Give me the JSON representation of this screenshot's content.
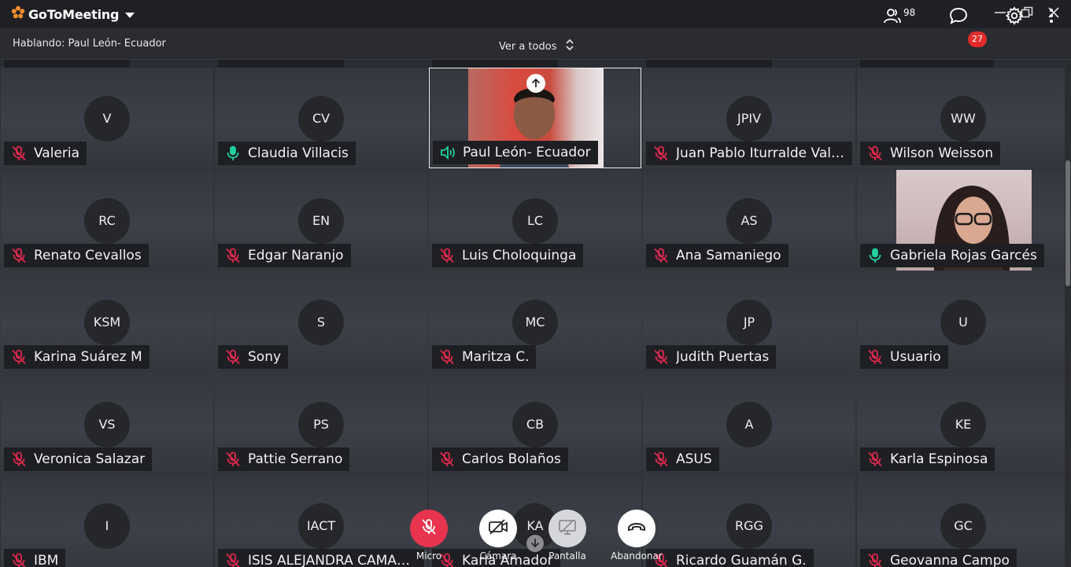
{
  "app": {
    "logo_text": "GoToMeeting",
    "accent": "#f68d2e"
  },
  "infobar": {
    "speaking": "Hablando: Paul León- Ecuador",
    "view_all": "Ver a todos",
    "participants_count": "98",
    "chat_badge": "27"
  },
  "colors": {
    "muted_icon": "#e0284f",
    "active_mic": "#1fd1a0",
    "end_call": "#ffffff",
    "mic_button": "#e8344e"
  },
  "top_row_names": [
    "",
    "",
    "",
    "",
    ""
  ],
  "tiles": [
    {
      "initials": "V",
      "name": "Valeria",
      "mic": "muted"
    },
    {
      "initials": "CV",
      "name": "Claudia Villacis",
      "mic": "on"
    },
    {
      "initials": "",
      "name": "Paul León- Ecuador",
      "mic": "speaking",
      "video": true
    },
    {
      "initials": "JPIV",
      "name": "Juan Pablo Iturralde Valar...",
      "mic": "muted"
    },
    {
      "initials": "WW",
      "name": "Wilson Weisson",
      "mic": "muted"
    },
    {
      "initials": "RC",
      "name": "Renato Cevallos",
      "mic": "muted"
    },
    {
      "initials": "EN",
      "name": "Edgar Naranjo",
      "mic": "muted"
    },
    {
      "initials": "LC",
      "name": "Luis Choloquinga",
      "mic": "muted"
    },
    {
      "initials": "AS",
      "name": "Ana Samaniego",
      "mic": "muted"
    },
    {
      "initials": "",
      "name": "Gabriela Rojas Garcés",
      "mic": "on",
      "video": true
    },
    {
      "initials": "KSM",
      "name": "Karina Suárez M",
      "mic": "muted"
    },
    {
      "initials": "S",
      "name": "Sony",
      "mic": "muted"
    },
    {
      "initials": "MC",
      "name": "Maritza C.",
      "mic": "muted"
    },
    {
      "initials": "JP",
      "name": "Judith Puertas",
      "mic": "muted"
    },
    {
      "initials": "U",
      "name": "Usuario",
      "mic": "muted"
    },
    {
      "initials": "VS",
      "name": "Veronica Salazar",
      "mic": "muted"
    },
    {
      "initials": "PS",
      "name": "Pattie Serrano",
      "mic": "muted"
    },
    {
      "initials": "CB",
      "name": "Carlos Bolaños",
      "mic": "muted"
    },
    {
      "initials": "A",
      "name": "ASUS",
      "mic": "muted"
    },
    {
      "initials": "KE",
      "name": "Karla Espinosa",
      "mic": "muted"
    },
    {
      "initials": "I",
      "name": "IBM",
      "mic": "muted"
    },
    {
      "initials": "IACT",
      "name": "ISIS ALEJANDRA CAMAR...",
      "mic": "muted"
    },
    {
      "initials": "KA",
      "name": "Karla Amador",
      "mic": "muted"
    },
    {
      "initials": "RGG",
      "name": "Ricardo Guamán G.",
      "mic": "muted"
    },
    {
      "initials": "GC",
      "name": "Geovanna Campo",
      "mic": "muted"
    }
  ],
  "controls": {
    "mic_label": "Micro",
    "camera_label": "Cámara",
    "screen_label": "Pantalla",
    "leave_label": "Abandonar"
  }
}
